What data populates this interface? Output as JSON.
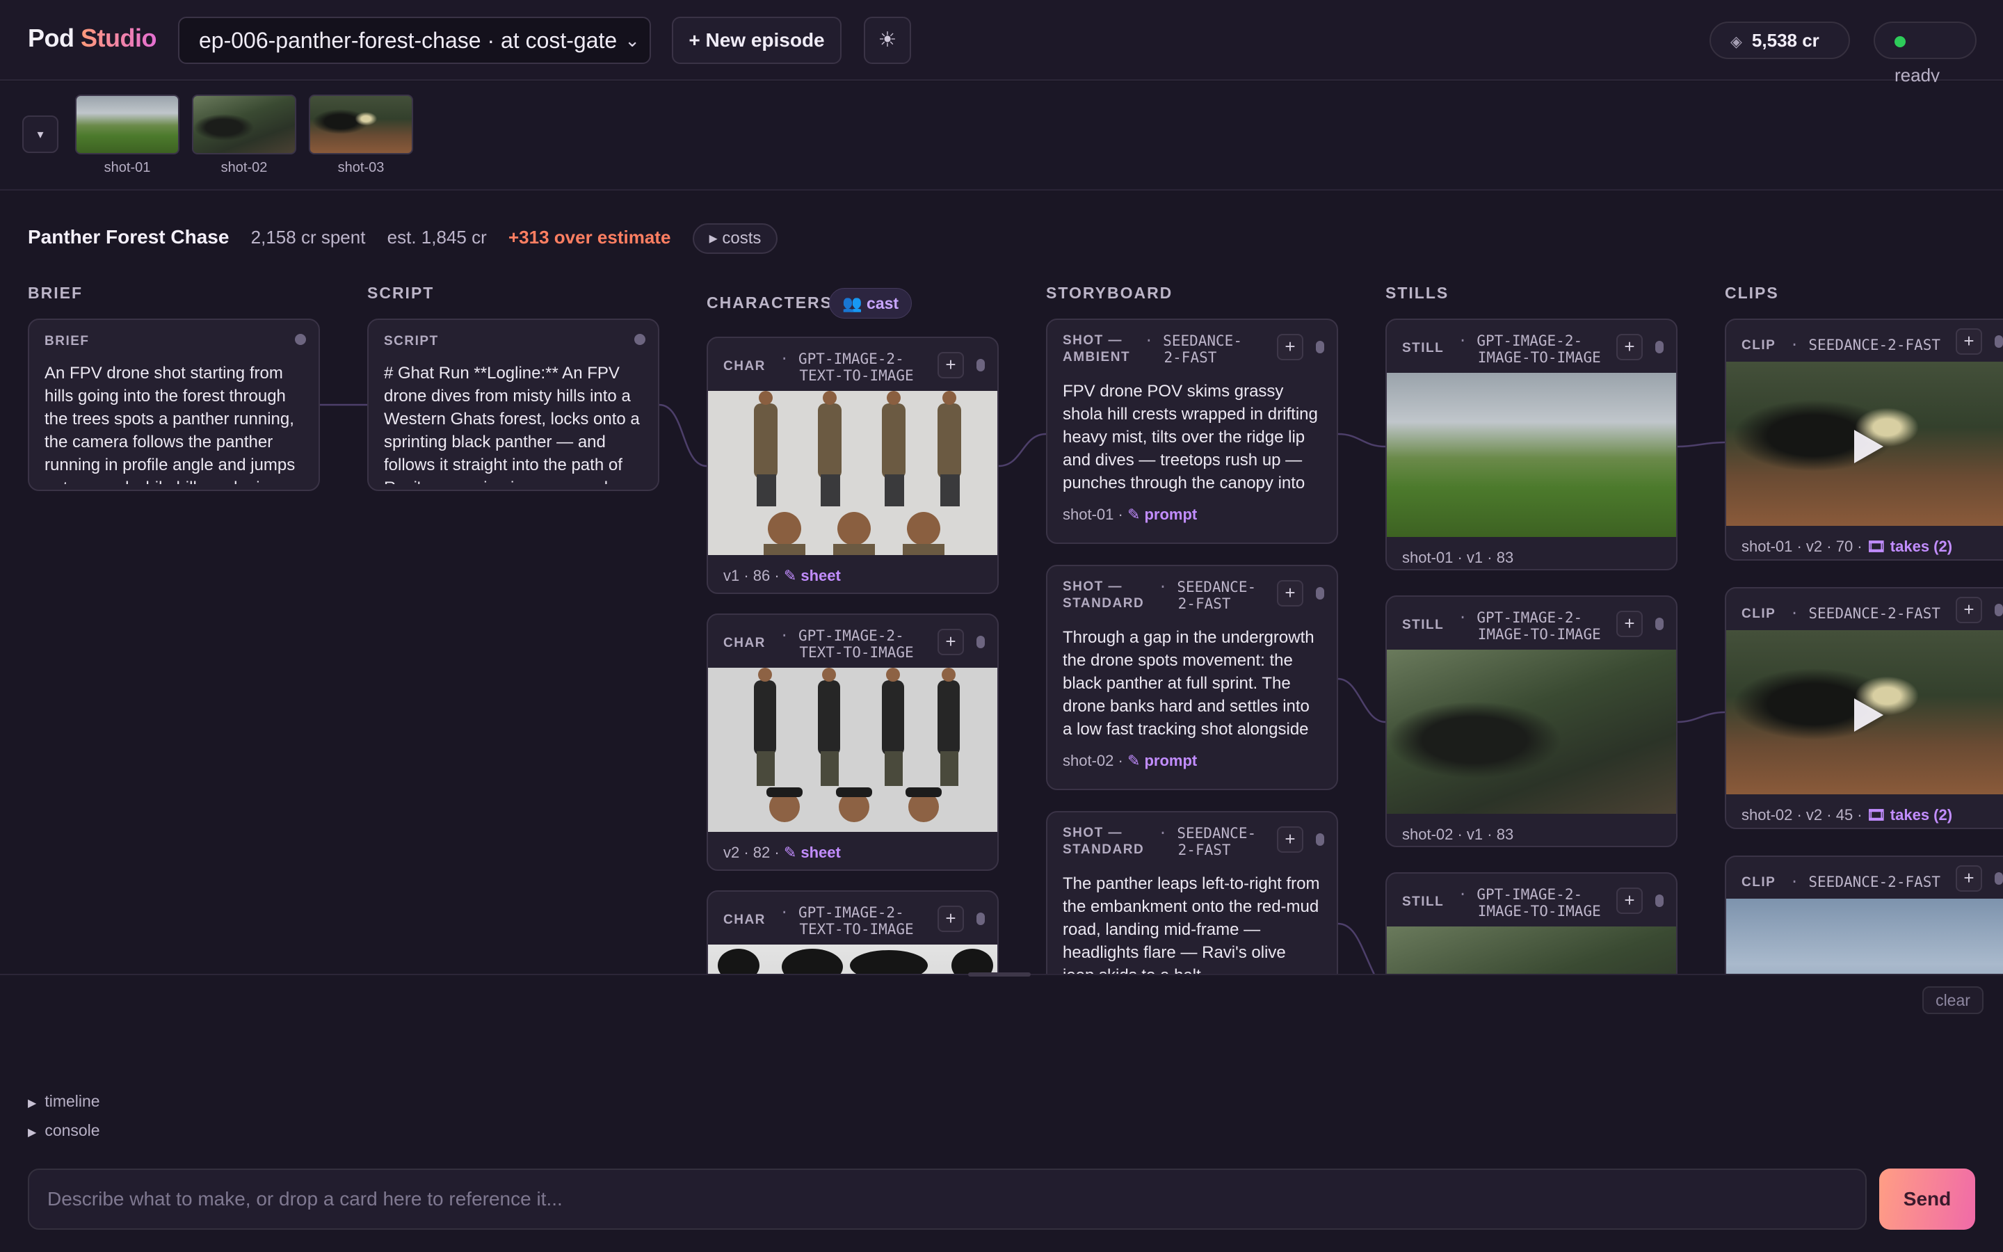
{
  "header": {
    "logo_part1": "Pod",
    "logo_part2": "Studio",
    "episode": "ep-006-panther-forest-chase · at cost-gate",
    "new_episode": "+ New episode",
    "theme_icon": "☀",
    "credits": "5,538 cr",
    "status": "ready"
  },
  "strip": {
    "shots": [
      "shot-01",
      "shot-02",
      "shot-03"
    ]
  },
  "summary": {
    "title": "Panther Forest Chase",
    "spent": "2,158 cr spent",
    "estimate": "est. 1,845 cr",
    "over": "+313 over estimate",
    "costs": "▸ costs"
  },
  "columns": {
    "brief": "BRIEF",
    "script": "SCRIPT",
    "characters": "CHARACTERS",
    "cast": "👥 cast",
    "storyboard": "STORYBOARD",
    "stills": "STILLS",
    "clips": "CLIPS"
  },
  "brief_card": {
    "type": "BRIEF",
    "text": "An FPV drone shot starting from hills going into the forest through the trees spots a panther running, the camera follows the panther running in profile angle and jumps onto a road while hills and a jeep"
  },
  "script_card": {
    "type": "SCRIPT",
    "text": "# Ghat Run **Logline:** An FPV drone dives from misty hills into a Western Ghats forest, locks onto a sprinting black panther — and follows it straight into the path of Ravi's oncoming jeep on a red-mud"
  },
  "characters": [
    {
      "type": "CHAR",
      "model_l1": "GPT-IMAGE-2-",
      "model_l2": "TEXT-TO-IMAGE",
      "foot_meta": "v1 · 86 · ",
      "foot_link": "✎ sheet"
    },
    {
      "type": "CHAR",
      "model_l1": "GPT-IMAGE-2-",
      "model_l2": "TEXT-TO-IMAGE",
      "foot_meta": "v2 · 82 · ",
      "foot_link": "✎ sheet"
    },
    {
      "type": "CHAR",
      "model_l1": "GPT-IMAGE-2-",
      "model_l2": "TEXT-TO-IMAGE",
      "foot_meta": "",
      "foot_link": ""
    }
  ],
  "storyboard": [
    {
      "type_l1": "SHOT —",
      "type_l2": "AMBIENT",
      "model_l1": "SEEDANCE-",
      "model_l2": "2-FAST",
      "text": "FPV drone POV skims grassy shola hill crests wrapped in drifting heavy mist, tilts over the ridge lip and dives — treetops rush up — punches through the canopy into dim green forest",
      "foot_meta": "shot-01 · ",
      "foot_link": "✎ prompt"
    },
    {
      "type_l1": "SHOT —",
      "type_l2": "STANDARD",
      "model_l1": "SEEDANCE-",
      "model_l2": "2-FAST",
      "text": "Through a gap in the undergrowth the drone spots movement: the black panther at full sprint. The drone banks hard and settles into a low fast tracking shot alongside it, profile angle, ferns whipping",
      "foot_meta": "shot-02 · ",
      "foot_link": "✎ prompt"
    },
    {
      "type_l1": "SHOT —",
      "type_l2": "STANDARD",
      "model_l1": "SEEDANCE-",
      "model_l2": "2-FAST",
      "text": "The panther leaps left-to-right from the embankment onto the red-mud road, landing mid-frame — headlights flare — Ravi's olive jeep skids to a halt",
      "foot_meta": "",
      "foot_link": ""
    }
  ],
  "stills": [
    {
      "type": "STILL",
      "model_l1": "GPT-IMAGE-2-",
      "model_l2": "IMAGE-TO-IMAGE",
      "foot": "shot-01 · v1 · 83"
    },
    {
      "type": "STILL",
      "model_l1": "GPT-IMAGE-2-",
      "model_l2": "IMAGE-TO-IMAGE",
      "foot": "shot-02 · v1 · 83"
    },
    {
      "type": "STILL",
      "model_l1": "GPT-IMAGE-2-",
      "model_l2": "IMAGE-TO-IMAGE",
      "foot": ""
    }
  ],
  "clips": [
    {
      "type": "CLIP",
      "model": "SEEDANCE-2-FAST",
      "foot_meta": "shot-01 · v2 · 70 · ",
      "foot_link": "🎞 takes (2)"
    },
    {
      "type": "CLIP",
      "model": "SEEDANCE-2-FAST",
      "foot_meta": "shot-02 · v2 · 45 · ",
      "foot_link": "🎞 takes (2)"
    },
    {
      "type": "CLIP",
      "model": "SEEDANCE-2-FAST",
      "foot_meta": "",
      "foot_link": ""
    }
  ],
  "bottom": {
    "clear": "clear",
    "timeline": "timeline",
    "console": "console",
    "prompt_placeholder": "Describe what to make, or drop a card here to reference it...",
    "send": "Send"
  },
  "icons": {
    "gem": "◈",
    "chevron": "⌄",
    "triangle": "▶",
    "plus": "+"
  },
  "colors": {
    "accent_purple": "#c28dff",
    "over_estimate": "#ff7f62",
    "status_ready": "#2ecc5a"
  }
}
